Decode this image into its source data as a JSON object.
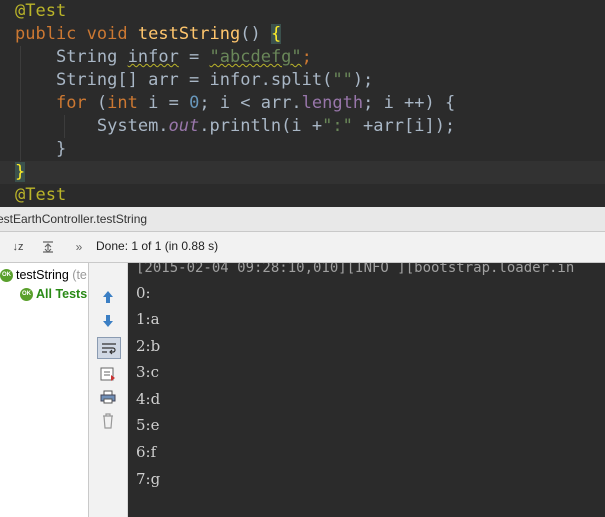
{
  "editor": {
    "lines": [
      {
        "t": "@Test"
      },
      {
        "t": "public void testString() {"
      },
      {
        "t": "    String infor = \"abcdefg\";"
      },
      {
        "t": "    String[] arr = infor.split(\"\");"
      },
      {
        "t": "    for (int i = 0; i < arr.length; i ++) {"
      },
      {
        "t": "        System.out.println(i +\":\" +arr[i]);"
      },
      {
        "t": "    }"
      },
      {
        "t": "}"
      },
      {
        "t": "@Test"
      }
    ],
    "tokens": {
      "ann1": "@Test",
      "public": "public",
      "void": "void",
      "method": "testString",
      "parens": "()",
      "open_brace": "{",
      "string_type": "String",
      "infor_var": "infor",
      "eq": " = ",
      "str_abc": "\"abcdefg\"",
      "semi": ";",
      "string_arr": "String[]",
      "arr_decl": " arr = ",
      "infor_split": "infor.split(",
      "empty_str": "\"\"",
      "close_call": ");",
      "for_kw": "for",
      "for_open": " (",
      "int_kw": "int",
      "i_eq": " i = ",
      "zero": "0",
      "cond": "; i < arr.",
      "length": "length",
      "incr": "; i ++) {",
      "system": "System.",
      "out": "out",
      "println": ".println(i +",
      "colon_str": "\":\"",
      "arr_i": " +arr[i]);",
      "close_inner": "}",
      "close_outer": "}",
      "ann2": "@Test"
    }
  },
  "tool_window": {
    "title": "estEarthController.testString",
    "status": "Done: 1 of 1 (in 0.88 s)",
    "sort_label": "↓z",
    "tree": [
      {
        "label": "testString",
        "suffix": "(te"
      },
      {
        "label": "All Tests"
      }
    ],
    "ok_badge": "OK"
  },
  "console": {
    "partial_line": "[2015-02-04 09:28:10,010][INFO ][bootstrap.loader.in",
    "lines": [
      "0:",
      "1:a",
      "2:b",
      "3:c",
      "4:d",
      "5:e",
      "6:f",
      "7:g"
    ]
  },
  "colors": {
    "editor_bg": "#2b2b2b",
    "keyword": "#cc7832",
    "method": "#ffc66d",
    "string": "#6a8759",
    "number": "#6897bb",
    "annotation": "#bbb529",
    "field": "#9876aa",
    "ok_green": "#5aa02c"
  }
}
